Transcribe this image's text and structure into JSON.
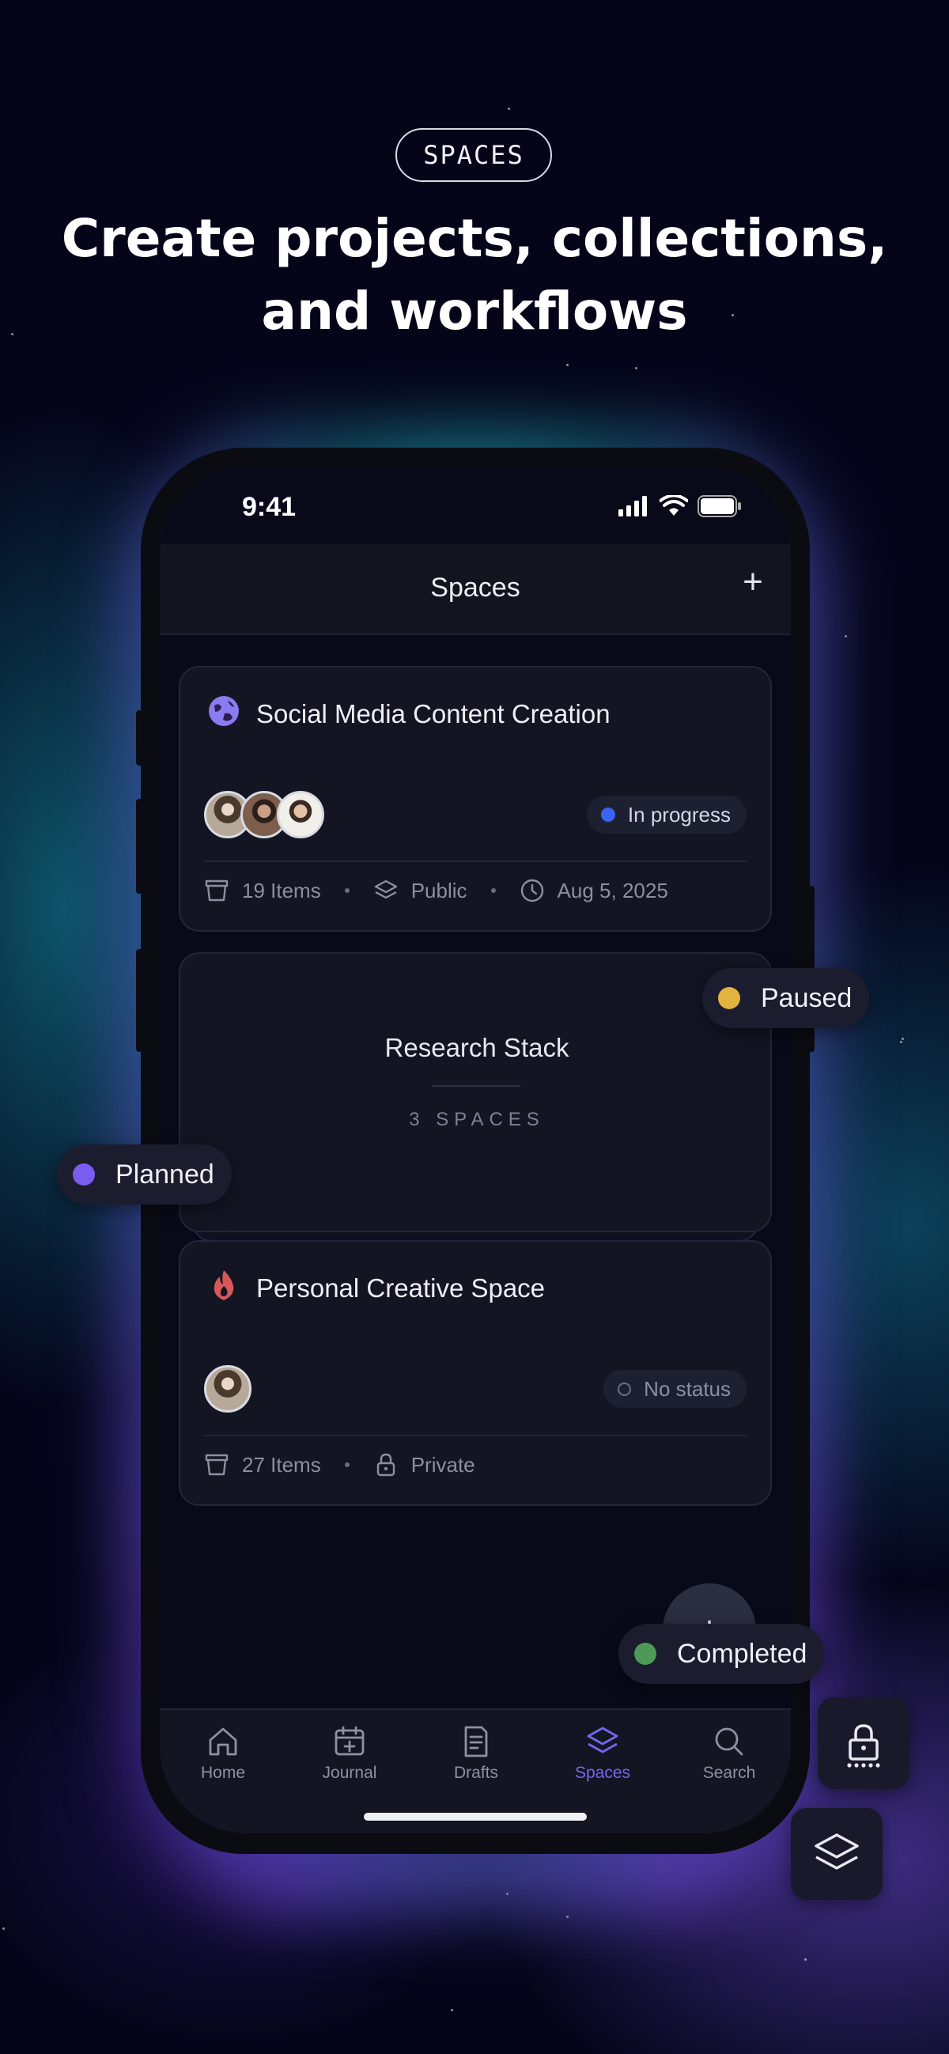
{
  "badge": "SPACES",
  "headline": {
    "line1": "Create projects, collections,",
    "line2": "and workflows"
  },
  "status_bar": {
    "time": "9:41"
  },
  "nav": {
    "title": "Spaces",
    "add_symbol": "+"
  },
  "cards": {
    "social": {
      "title": "Social Media Content Creation",
      "icon": "globe-icon",
      "status": "In progress",
      "status_color": "#3a64f2",
      "items": "19 Items",
      "visibility": "Public",
      "date": "Aug 5, 2025"
    },
    "research": {
      "title": "Research Stack",
      "subtitle": "3 SPACES"
    },
    "personal": {
      "title": "Personal Creative Space",
      "icon": "flame-icon",
      "status": "No status",
      "items": "27 Items",
      "visibility": "Private"
    }
  },
  "floating": {
    "paused": {
      "label": "Paused",
      "color": "#e3b341"
    },
    "planned": {
      "label": "Planned",
      "color": "#7a5cf0"
    },
    "completed": {
      "label": "Completed",
      "color": "#4c9a55"
    }
  },
  "fab_symbol": "+",
  "tabs": [
    {
      "label": "Home",
      "icon": "home-icon"
    },
    {
      "label": "Journal",
      "icon": "calendar-icon"
    },
    {
      "label": "Drafts",
      "icon": "document-icon"
    },
    {
      "label": "Spaces",
      "icon": "layers-icon",
      "active": true
    },
    {
      "label": "Search",
      "icon": "search-icon"
    }
  ],
  "colors": {
    "accent": "#7467f0",
    "background": "#05051a",
    "card": "#131523"
  }
}
